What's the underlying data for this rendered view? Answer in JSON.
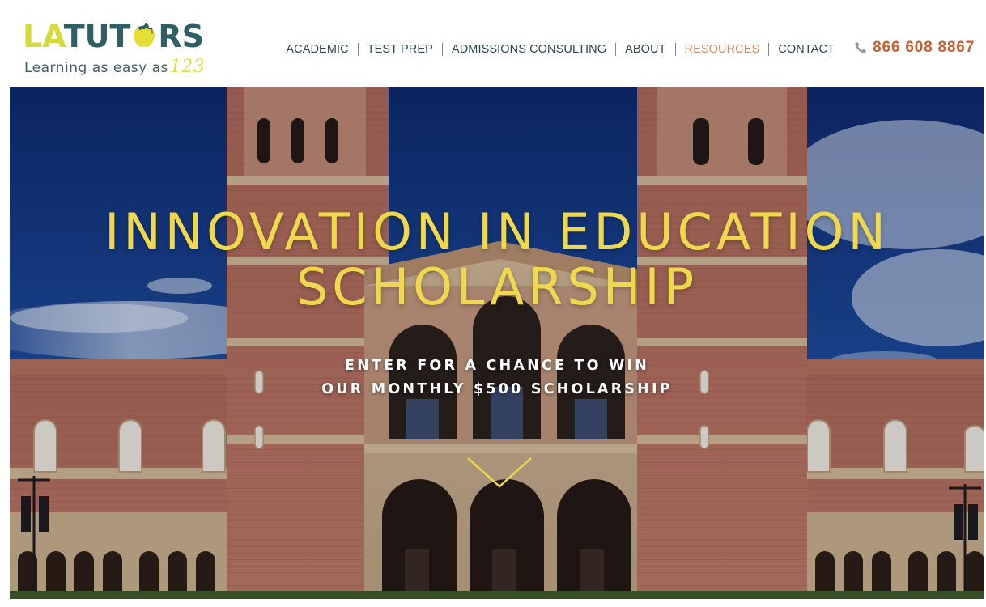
{
  "brand": {
    "logo_prefix": "LA",
    "logo_middle": "TUT",
    "logo_suffix": "RS",
    "tagline": "Learning as easy as",
    "tagline_number": "123",
    "colors": {
      "yellow": "#d8d93b",
      "teal": "#2e5f66"
    }
  },
  "nav": {
    "items": [
      {
        "label": "ACADEMIC",
        "active": false
      },
      {
        "label": "TEST PREP",
        "active": false
      },
      {
        "label": "ADMISSIONS CONSULTING",
        "active": false
      },
      {
        "label": "ABOUT",
        "active": false
      },
      {
        "label": "RESOURCES",
        "active": true
      },
      {
        "label": "CONTACT",
        "active": false
      }
    ],
    "active_color": "#d58c5c"
  },
  "phone": {
    "icon": "phone-icon",
    "number": "866 608 8867",
    "color": "#c95f2e"
  },
  "hero": {
    "title_line1": "INNOVATION IN EDUCATION",
    "title_line2": "SCHOLARSHIP",
    "subtitle_line1": "ENTER FOR A CHANCE TO WIN",
    "subtitle_line2": "OUR MONTHLY $500 SCHOLARSHIP",
    "title_color": "#f0d84e",
    "scroll_icon": "chevron-down-icon"
  }
}
